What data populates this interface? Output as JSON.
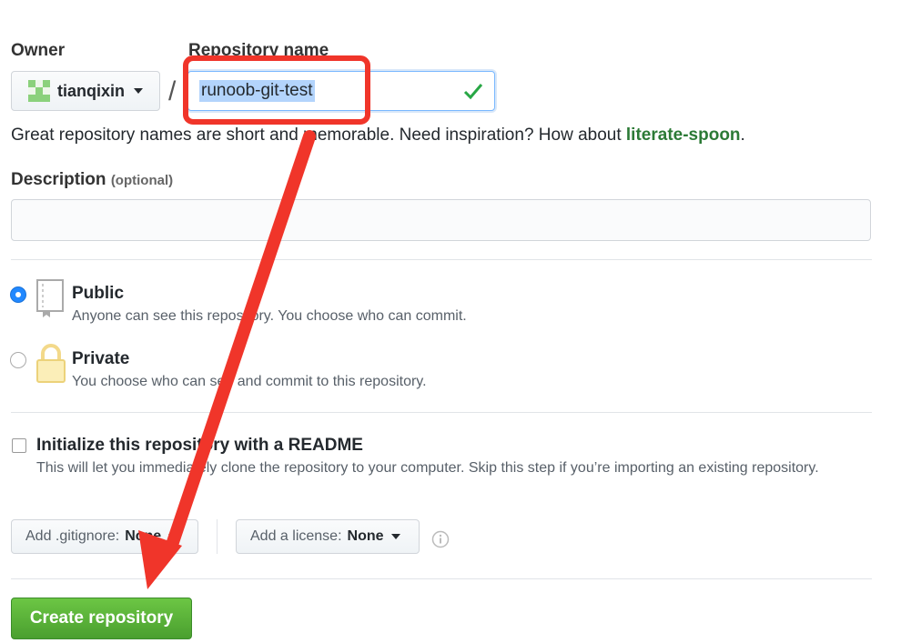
{
  "owner": {
    "label": "Owner",
    "value": "tianqixin"
  },
  "repo": {
    "label": "Repository name",
    "value": "runoob-git-test",
    "separator": "/"
  },
  "hint": {
    "text": "Great repository names are short and memorable. Need inspiration? How about ",
    "suggestion": "literate-spoon",
    "end": "."
  },
  "description": {
    "label": "Description",
    "optional": "(optional)",
    "value": ""
  },
  "visibility": {
    "public": {
      "title": "Public",
      "desc": "Anyone can see this repository. You choose who can commit.",
      "selected": true
    },
    "private": {
      "title": "Private",
      "desc": "You choose who can see and commit to this repository.",
      "selected": false
    }
  },
  "readme": {
    "title": "Initialize this repository with a README",
    "desc": "This will let you immediately clone the repository to your computer. Skip this step if you’re importing an existing repository.",
    "checked": false
  },
  "gitignore": {
    "label": "Add .gitignore:",
    "value": "None"
  },
  "license": {
    "label": "Add a license:",
    "value": "None"
  },
  "create_button": "Create repository",
  "colors": {
    "accent_blue": "#2188ff",
    "create_green": "#5cb83a",
    "annotation_red": "#f0352a",
    "suggestion_green": "#2c7a36"
  },
  "icons": [
    "identicon",
    "caret-down-icon",
    "check-icon",
    "repo-book-icon",
    "lock-icon",
    "info-icon"
  ]
}
